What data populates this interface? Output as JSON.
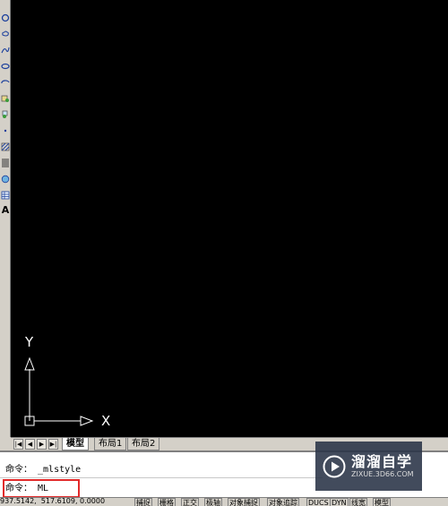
{
  "toolbar": {
    "icons": [
      "circle-icon",
      "revision-cloud-icon",
      "spline-icon",
      "ellipse-icon",
      "ellipse-arc-icon",
      "insert-block-icon",
      "make-block-icon",
      "point-icon",
      "hatch-icon",
      "gradient-icon",
      "region-icon",
      "table-icon",
      "multiline-text-icon"
    ],
    "text_label": "A"
  },
  "ucs": {
    "x_label": "X",
    "y_label": "Y"
  },
  "layout_tabs": {
    "nav": [
      "first-tab",
      "previous-tab",
      "next-tab",
      "last-tab"
    ],
    "tabs": [
      {
        "label": "模型",
        "active": true
      },
      {
        "label": "布局1",
        "active": false
      },
      {
        "label": "布局2",
        "active": false
      }
    ]
  },
  "command": {
    "history": "命令： _mlstyle",
    "current": "命令： ML"
  },
  "watermark": {
    "title": "溜溜自学",
    "url": "ZIXUE.3D66.COM"
  },
  "statusbar": {
    "coords": "937.5142,  517.6109, 0.0000",
    "buttons": [
      "捕捉",
      "栅格",
      "正交",
      "极轴",
      "对象捕捉",
      "对象追踪",
      "DUCS",
      "DYN",
      "线宽",
      "模型"
    ]
  },
  "colors": {
    "canvas": "#000000",
    "highlight": "#e22a2a",
    "chrome": "#d4d0c8"
  }
}
